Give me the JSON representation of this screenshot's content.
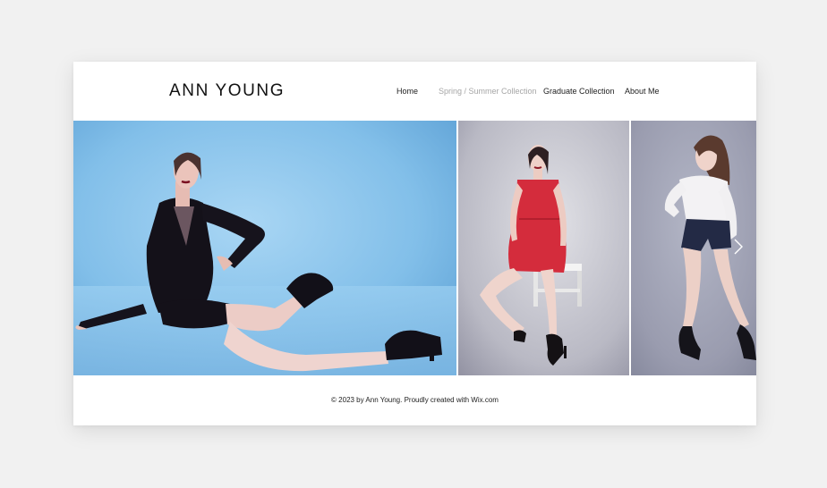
{
  "header": {
    "logo": "ANN YOUNG",
    "nav": [
      {
        "label": "Home",
        "active": false
      },
      {
        "label": "Spring / Summer Collection",
        "active": true
      },
      {
        "label": "Graduate Collection",
        "active": false
      },
      {
        "label": "About Me",
        "active": false
      }
    ]
  },
  "gallery": {
    "next_icon": "chevron-right-icon"
  },
  "footer": {
    "text": "© 2023 by Ann Young. Proudly created with Wix.com"
  },
  "colors": {
    "page_background": "#f1f1f1",
    "site_background": "#ffffff",
    "text": "#222222",
    "nav_active": "#a6a6a6"
  }
}
